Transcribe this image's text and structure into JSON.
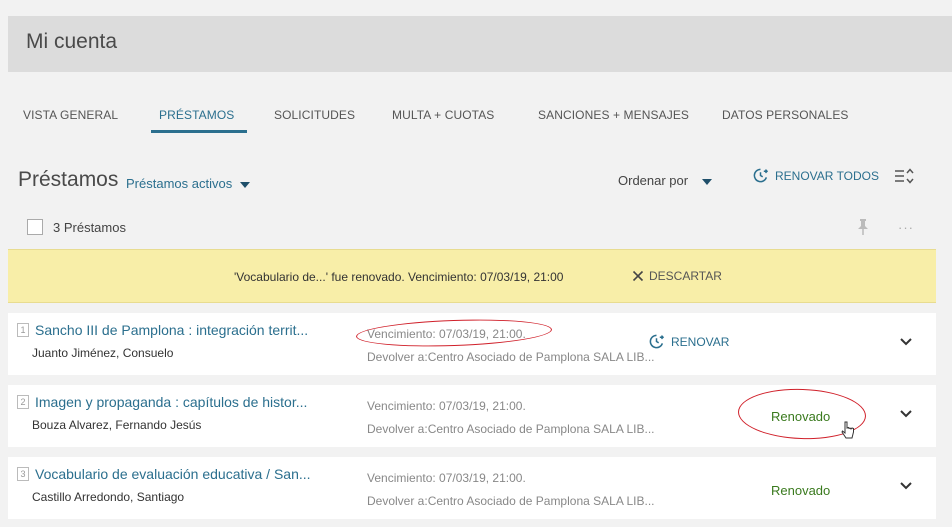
{
  "header": {
    "title": "Mi cuenta"
  },
  "tabs": [
    {
      "label": "VISTA GENERAL"
    },
    {
      "label": "PRÉSTAMOS"
    },
    {
      "label": "SOLICITUDES"
    },
    {
      "label": "MULTA + CUOTAS"
    },
    {
      "label": "SANCIONES + MENSAJES"
    },
    {
      "label": "DATOS PERSONALES"
    }
  ],
  "section": {
    "title": "Préstamos",
    "filter": "Préstamos activos",
    "sort_label": "Ordenar por",
    "renew_all": "RENOVAR TODOS",
    "count": "3 Préstamos",
    "more": "···"
  },
  "banner": {
    "message": "'Vocabulario de...' fue renovado. Vencimiento: 07/03/19, 21:00",
    "dismiss": "DESCARTAR"
  },
  "loans": [
    {
      "num": "1",
      "title": "Sancho III de Pamplona : integración territ...",
      "author": "Juanto Jiménez, Consuelo",
      "due": "Vencimiento: 07/03/19, 21:00.",
      "return_to": "Devolver a:Centro Asociado de Pamplona SALA LIB...",
      "action": "RENOVAR"
    },
    {
      "num": "2",
      "title": "Imagen y propaganda : capítulos de histor...",
      "author": "Bouza Alvarez, Fernando Jesús",
      "due": "Vencimiento: 07/03/19, 21:00.",
      "return_to": "Devolver a:Centro Asociado de Pamplona SALA LIB...",
      "status": "Renovado"
    },
    {
      "num": "3",
      "title": "Vocabulario de evaluación educativa / San...",
      "author": "Castillo Arredondo, Santiago",
      "due": "Vencimiento: 07/03/19, 21:00.",
      "return_to": "Devolver a:Centro Asociado de Pamplona SALA LIB...",
      "status": "Renovado"
    }
  ],
  "colors": {
    "accent": "#2b6f8e",
    "renewed": "#3a7a1e",
    "banner": "#f8eea8",
    "annotation": "#d0202a"
  },
  "icons": [
    "clock-arrow-icon",
    "list-sort-icon",
    "pin-icon",
    "close-icon",
    "chevron-down-icon",
    "mouse-cursor-icon"
  ]
}
